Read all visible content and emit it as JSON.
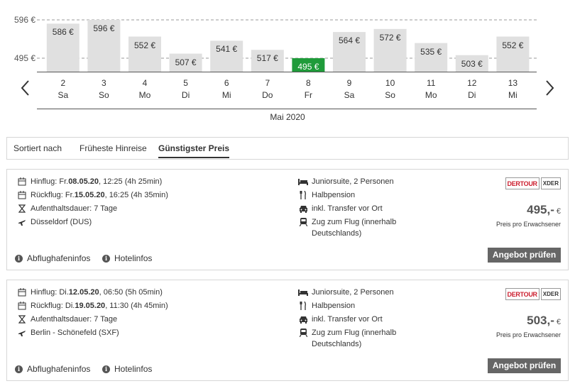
{
  "chart_data": {
    "type": "bar",
    "title": "",
    "xlabel": "Mai 2020",
    "ylabel": "",
    "reference_lines": [
      {
        "label": "596 €",
        "value": 596
      },
      {
        "label": "495 €",
        "value": 495
      }
    ],
    "categories": [
      "2",
      "3",
      "4",
      "5",
      "6",
      "7",
      "8",
      "9",
      "10",
      "11",
      "12",
      "13"
    ],
    "weekdays": [
      "Sa",
      "So",
      "Mo",
      "Di",
      "Mi",
      "Do",
      "Fr",
      "Sa",
      "So",
      "Mo",
      "Di",
      "Mi"
    ],
    "values": [
      586,
      596,
      552,
      507,
      541,
      517,
      495,
      564,
      572,
      535,
      503,
      552
    ],
    "value_labels": [
      "586 €",
      "596 €",
      "552 €",
      "507 €",
      "541 €",
      "517 €",
      "495 €",
      "564 €",
      "572 €",
      "535 €",
      "503 €",
      "552 €"
    ],
    "highlight_index": 6,
    "colors": {
      "bar": "#e0e0e0",
      "highlight": "#1f9b3a",
      "refline": "#999999"
    },
    "legend": "none",
    "grid": false
  },
  "nav": {
    "prev_icon": "chevron-left-icon",
    "next_icon": "chevron-right-icon"
  },
  "sort": {
    "label": "Sortiert nach",
    "options": [
      "Früheste Hinreise",
      "Günstigster Preis"
    ],
    "active": "Günstigster Preis"
  },
  "offers": [
    {
      "outbound_prefix": "Hinflug: Fr. ",
      "outbound_date": "08.05.20",
      "outbound_suffix": ", 12:25 (4h 25min)",
      "return_prefix": "Rückflug: Fr. ",
      "return_date": "15.05.20",
      "return_suffix": ", 16:25 (4h 35min)",
      "stay": "Aufenthaltsdauer: 7 Tage",
      "airport": "Düsseldorf (DUS)",
      "room": "Juniorsuite, 2 Personen",
      "board": "Halbpension",
      "transfer": "inkl. Transfer vor Ort",
      "train_line1": "Zug zum Flug (innerhalb",
      "train_line2": "Deutschlands)",
      "operator_logo": "DERTOUR",
      "operator_logo2": "XDER",
      "price": "495,-",
      "currency": "€",
      "price_note": "Preis pro Erwachsener",
      "button": "Angebot prüfen",
      "link_airport": "Abflughafeninfos",
      "link_hotel": "Hotelinfos"
    },
    {
      "outbound_prefix": "Hinflug: Di. ",
      "outbound_date": "12.05.20",
      "outbound_suffix": ", 06:50 (5h 05min)",
      "return_prefix": "Rückflug: Di. ",
      "return_date": "19.05.20",
      "return_suffix": ", 11:30 (4h 45min)",
      "stay": "Aufenthaltsdauer: 7 Tage",
      "airport": "Berlin - Schönefeld (SXF)",
      "room": "Juniorsuite, 2 Personen",
      "board": "Halbpension",
      "transfer": "inkl. Transfer vor Ort",
      "train_line1": "Zug zum Flug (innerhalb",
      "train_line2": "Deutschlands)",
      "operator_logo": "DERTOUR",
      "operator_logo2": "XDER",
      "price": "503,-",
      "currency": "€",
      "price_note": "Preis pro Erwachsener",
      "button": "Angebot prüfen",
      "link_airport": "Abflughafeninfos",
      "link_hotel": "Hotelinfos"
    }
  ]
}
